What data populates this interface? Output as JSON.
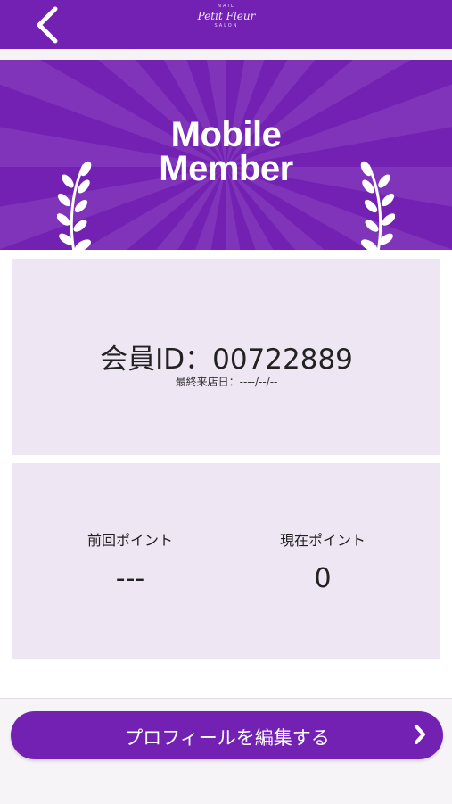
{
  "header": {
    "back_icon": "chevron-left-icon",
    "logo": {
      "top": "NAIL",
      "script": "Petit Fleur",
      "bottom": "SALON"
    }
  },
  "banner": {
    "title_line1": "Mobile",
    "title_line2": "Member",
    "decoration_icon": "laurel-icon"
  },
  "member": {
    "id_text": "会員ID：00722889",
    "last_visit": "最終来店日：----/--/--"
  },
  "points": {
    "previous_label": "前回ポイント",
    "previous_value": "---",
    "current_label": "現在ポイント",
    "current_value": "0"
  },
  "actions": {
    "edit_profile_label": "プロフィールを編集する",
    "edit_profile_icon": "chevron-right-icon"
  },
  "colors": {
    "brand": "#7321b3",
    "card": "#efe6f3",
    "text": "#222222"
  }
}
